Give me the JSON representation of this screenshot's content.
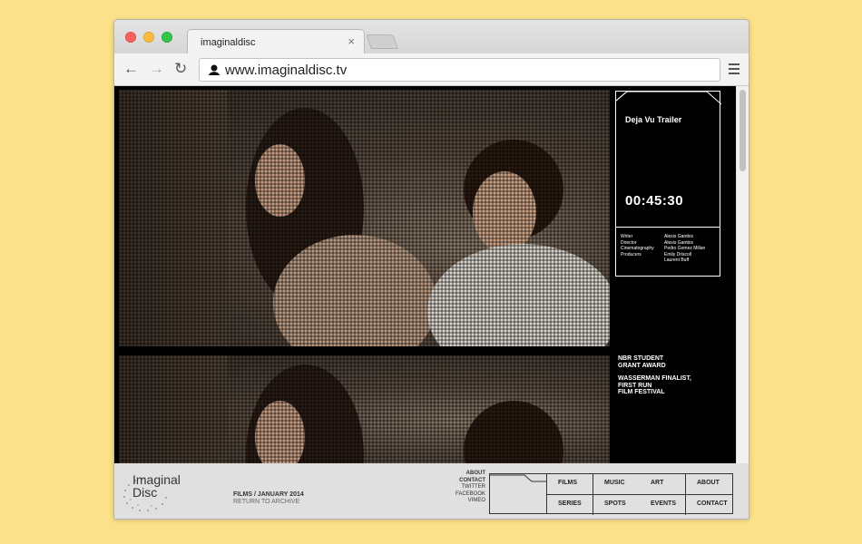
{
  "browser": {
    "tab_title": "imaginaldisc",
    "tab_close": "×",
    "url": "www.imaginaldisc.tv",
    "icons": {
      "back": "back-arrow-icon",
      "forward": "forward-arrow-icon",
      "reload": "reload-icon",
      "menu": "hamburger-menu-icon"
    },
    "colors": {
      "close": "#fc605c",
      "minimize": "#fdbc40",
      "zoom": "#34c84a"
    }
  },
  "film": {
    "title": "Deja Vu Trailer",
    "timecode": "00:45:30",
    "credits": [
      {
        "role": "Writer",
        "name": "Alexis Gambis"
      },
      {
        "role": "Director",
        "name": "Alexis Gambis"
      },
      {
        "role": "Cinematography",
        "name": "Pedro Gomez Millan"
      },
      {
        "role": "Producers",
        "name": "Emily Driscoll"
      },
      {
        "role": "",
        "name": "Laurent Buff"
      }
    ],
    "awards": [
      "NBR STUDENT\nGRANT AWARD",
      "WASSERMAN FINALIST,\nFIRST RUN\nFILM FESTIVAL"
    ]
  },
  "footer": {
    "logo_line1": "Imaginal",
    "logo_line2": "Disc",
    "breadcrumb": "FILMS / JANUARY 2014",
    "return_link": "RETURN TO ARCHIVE",
    "side_links": [
      "ABOUT",
      "CONTACT",
      "TWITTER",
      "FACEBOOK",
      "VIMEO"
    ],
    "nav_items": [
      "FILMS",
      "MUSIC",
      "ART",
      "ABOUT",
      "SERIES",
      "SPOTS",
      "EVENTS",
      "CONTACT"
    ]
  }
}
